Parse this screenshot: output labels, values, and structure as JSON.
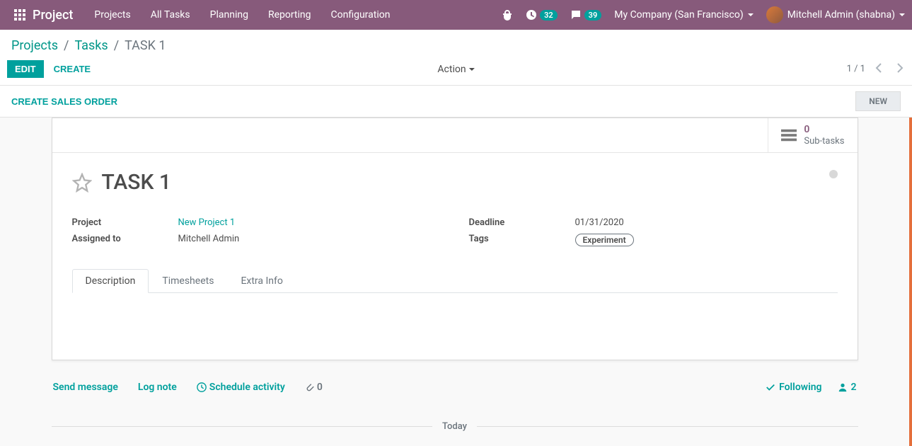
{
  "nav": {
    "brand": "Project",
    "menu": [
      "Projects",
      "All Tasks",
      "Planning",
      "Reporting",
      "Configuration"
    ],
    "clock_badge": "32",
    "chat_badge": "39",
    "company": "My Company (San Francisco)",
    "user": "Mitchell Admin (shabna)"
  },
  "breadcrumb": {
    "items": [
      "Projects",
      "Tasks"
    ],
    "current": "TASK 1"
  },
  "controls": {
    "edit": "EDIT",
    "create": "CREATE",
    "action": "Action",
    "pager": "1 / 1"
  },
  "statusbar": {
    "create_sales_order": "CREATE SALES ORDER",
    "stage": "NEW"
  },
  "stat": {
    "subtasks_count": "0",
    "subtasks_label": "Sub-tasks"
  },
  "task": {
    "title": "TASK 1",
    "fields": {
      "project_label": "Project",
      "project_value": "New Project 1",
      "assigned_label": "Assigned to",
      "assigned_value": "Mitchell Admin",
      "deadline_label": "Deadline",
      "deadline_value": "01/31/2020",
      "tags_label": "Tags",
      "tag_value": "Experiment"
    }
  },
  "tabs": [
    "Description",
    "Timesheets",
    "Extra Info"
  ],
  "chatter": {
    "send": "Send message",
    "log": "Log note",
    "schedule": "Schedule activity",
    "attach_count": "0",
    "following": "Following",
    "followers": "2",
    "today": "Today"
  }
}
